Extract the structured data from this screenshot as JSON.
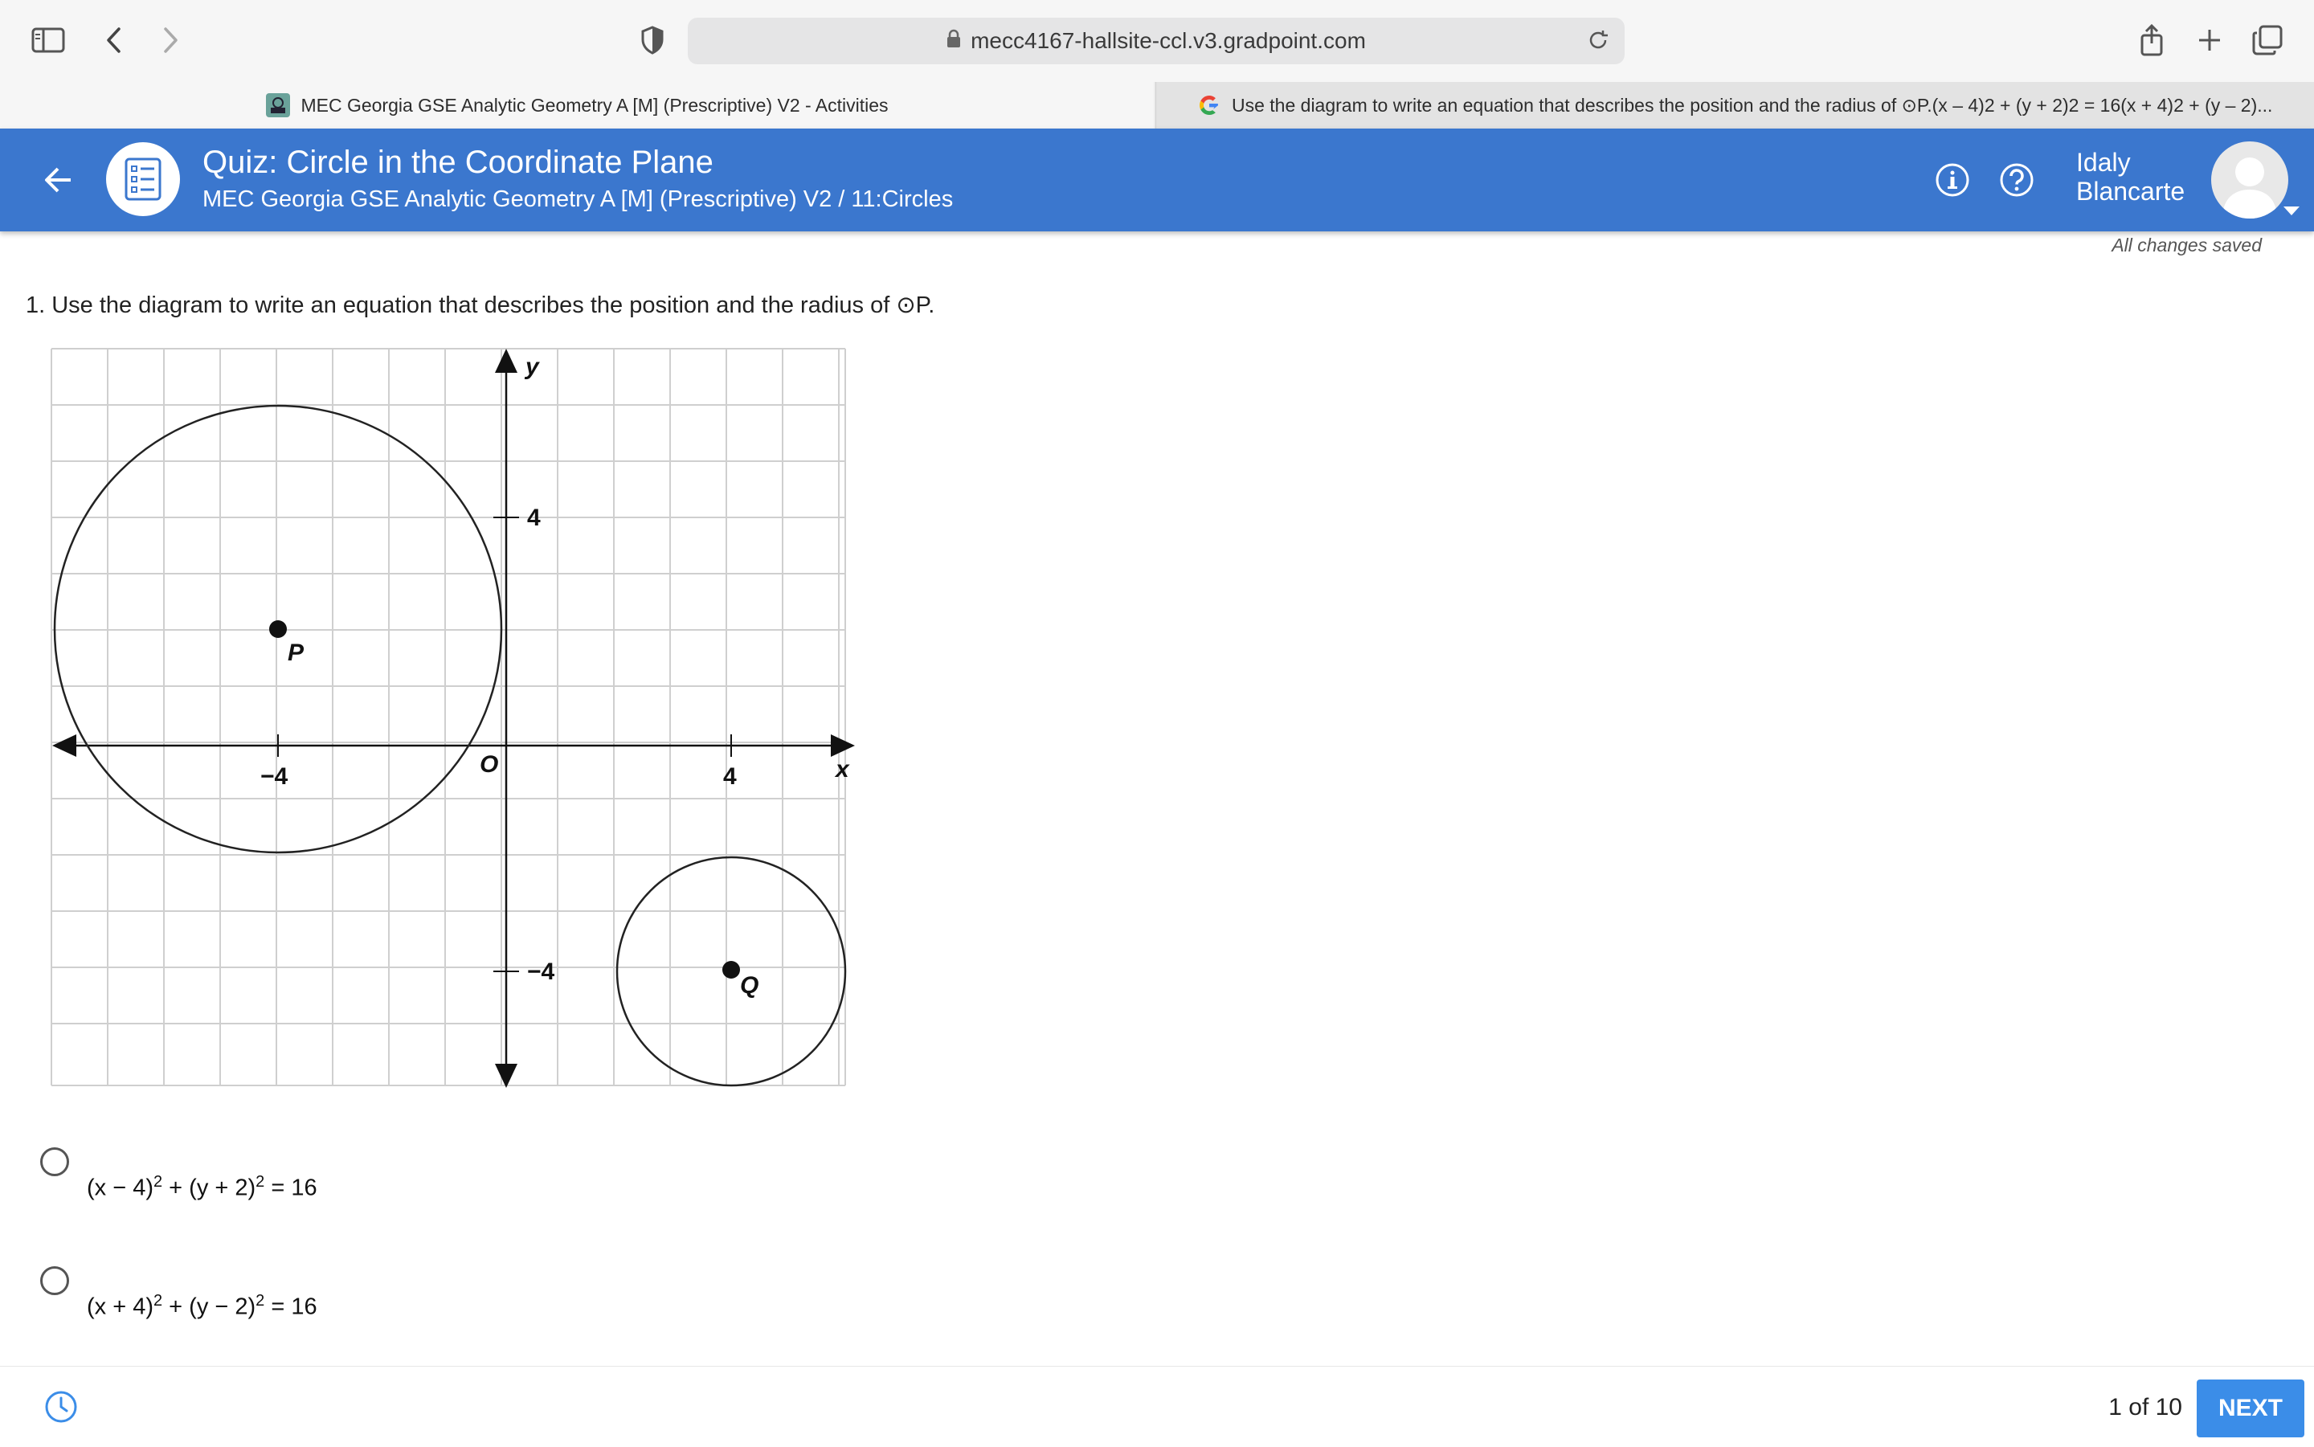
{
  "browser": {
    "url": "mecc4167-hallsite-ccl.v3.gradpoint.com",
    "tabs": [
      {
        "title": "MEC Georgia GSE Analytic Geometry A [M] (Prescriptive) V2 - Activities"
      },
      {
        "title": "Use the diagram to write an equation that describes the position and the radius of ⊙P.(x – 4)2 + (y + 2)2 = 16(x + 4)2 + (y – 2)..."
      }
    ]
  },
  "header": {
    "title": "Quiz: Circle in the Coordinate Plane",
    "subtitle": "MEC Georgia GSE Analytic Geometry A [M] (Prescriptive) V2 / 11:Circles",
    "user_first": "Idaly",
    "user_last": "Blancarte",
    "status": "All changes saved"
  },
  "question": {
    "text": "1. Use the diagram to write an equation that describes the position and the radius of ⊙P."
  },
  "graph": {
    "axis_labels": {
      "x": "x",
      "y": "y",
      "origin": "O"
    },
    "tick_labels": {
      "x_neg4": "−4",
      "x_pos4": "4",
      "y_pos4": "4",
      "y_neg4": "−4"
    },
    "grid_range": {
      "x": [
        -8,
        6
      ],
      "y": [
        -6,
        7
      ]
    },
    "circles": [
      {
        "name": "P",
        "center": [
          -4,
          2
        ],
        "radius": 4
      },
      {
        "name": "Q",
        "center": [
          4,
          -4
        ],
        "radius": 2
      }
    ]
  },
  "choices": [
    {
      "a": "(x − 4)",
      "a_exp": "2",
      "b": " + (y + 2)",
      "b_exp": "2",
      "rhs": " = 16"
    },
    {
      "a": "(x + 4)",
      "a_exp": "2",
      "b": " + (y − 2)",
      "b_exp": "2",
      "rhs": " = 16"
    }
  ],
  "footer": {
    "pager": "1 of 10",
    "next_label": "NEXT"
  }
}
